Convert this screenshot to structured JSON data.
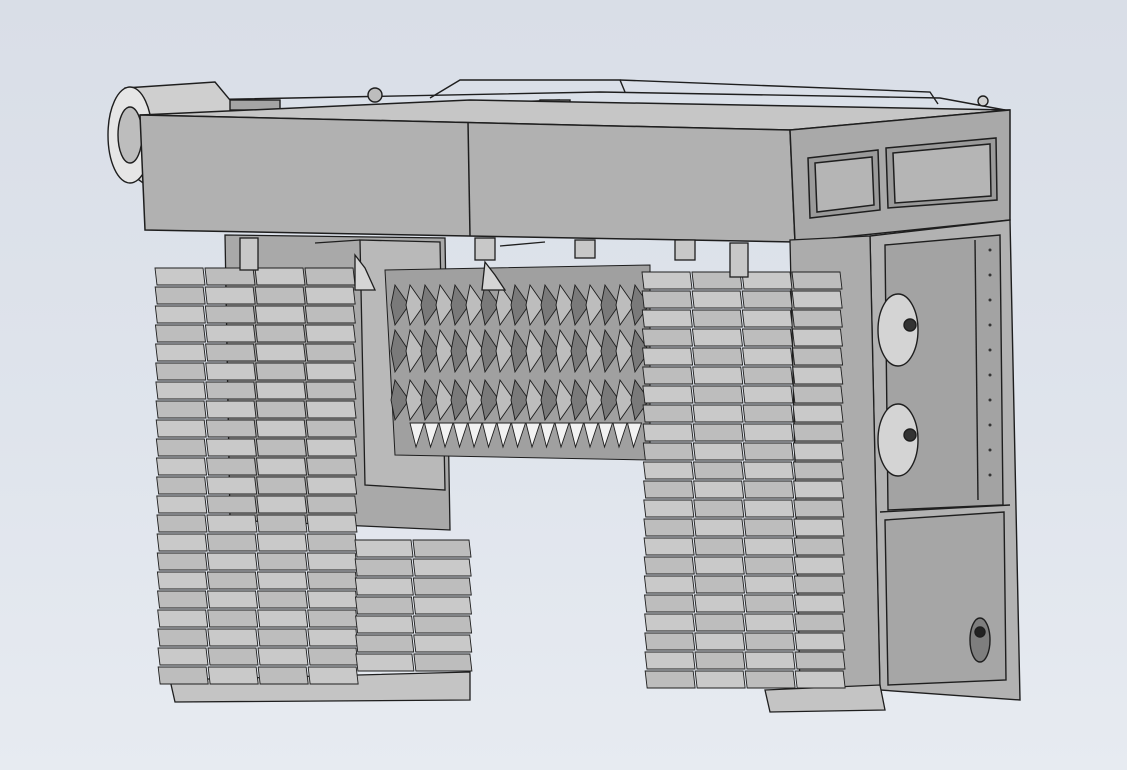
{
  "viewport": {
    "background_top": "#d9dee7",
    "background_bottom": "#e7ebf1"
  },
  "model": {
    "body_color": "#b3b3b3",
    "panel_light": "#c9c9c9",
    "panel_dark": "#8f8f8f",
    "edge_color": "#1e1e1e",
    "fin_face": "#bdbdbd",
    "fin_shadow": "#7a7a7a",
    "blade_white": "#f2f2f2",
    "icons": [
      "blower-motor",
      "fan-housing",
      "drive-wheel",
      "lifting-eye"
    ]
  }
}
